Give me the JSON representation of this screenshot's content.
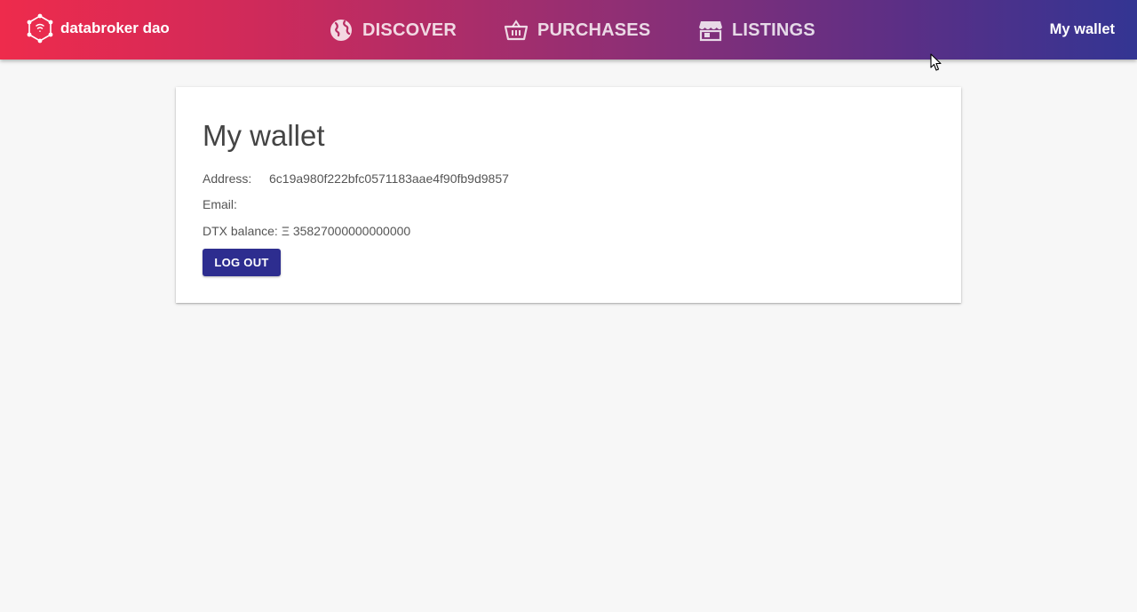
{
  "header": {
    "brand": {
      "name": "databroker dao",
      "icon": "databroker-logo-icon"
    },
    "nav": [
      {
        "label": "DISCOVER",
        "icon": "globe-icon"
      },
      {
        "label": "PURCHASES",
        "icon": "basket-icon"
      },
      {
        "label": "LISTINGS",
        "icon": "storefront-icon"
      }
    ],
    "wallet_link": "My wallet"
  },
  "wallet": {
    "title": "My wallet",
    "address_label": "Address:",
    "address_value": "6c19a980f222bfc0571183aae4f90fb9d9857",
    "email_label": "Email:",
    "email_value": "",
    "balance_label": "DTX balance:",
    "balance_value": "Ξ 35827000000000000",
    "logout_label": "LOG OUT"
  },
  "colors": {
    "header_gradient_start": "#ee2b4c",
    "header_gradient_end": "#333593",
    "button_primary": "#2d2d8f",
    "background": "#f7f7f7"
  }
}
